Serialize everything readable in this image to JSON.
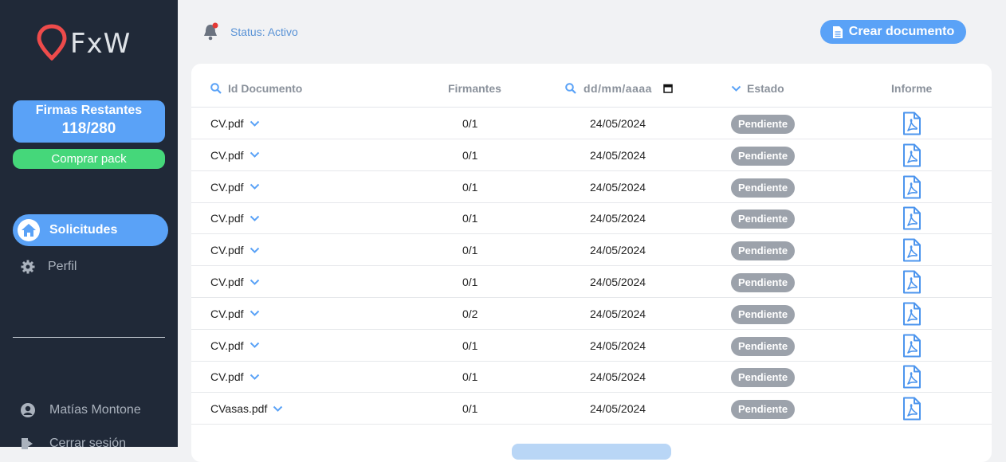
{
  "sidebar": {
    "logo_text": "FxW",
    "firmas_title": "Firmas Restantes",
    "firmas_value": "118/280",
    "comprar_label": "Comprar pack",
    "nav_solicitudes": "Solicitudes",
    "nav_perfil": "Perfil",
    "user_name": "Matías Montone",
    "logout_label": "Cerrar sesión"
  },
  "header": {
    "status": "Status: Activo",
    "crear_label": "Crear documento"
  },
  "table": {
    "headers": {
      "id": "Id Documento",
      "firmantes": "Firmantes",
      "fecha_placeholder": "dd/mm/aaaa",
      "estado": "Estado",
      "informe": "Informe"
    },
    "rows": [
      {
        "doc": "CV.pdf",
        "firmantes": "0/1",
        "fecha": "24/05/2024",
        "estado": "Pendiente"
      },
      {
        "doc": "CV.pdf",
        "firmantes": "0/1",
        "fecha": "24/05/2024",
        "estado": "Pendiente"
      },
      {
        "doc": "CV.pdf",
        "firmantes": "0/1",
        "fecha": "24/05/2024",
        "estado": "Pendiente"
      },
      {
        "doc": "CV.pdf",
        "firmantes": "0/1",
        "fecha": "24/05/2024",
        "estado": "Pendiente"
      },
      {
        "doc": "CV.pdf",
        "firmantes": "0/1",
        "fecha": "24/05/2024",
        "estado": "Pendiente"
      },
      {
        "doc": "CV.pdf",
        "firmantes": "0/1",
        "fecha": "24/05/2024",
        "estado": "Pendiente"
      },
      {
        "doc": "CV.pdf",
        "firmantes": "0/2",
        "fecha": "24/05/2024",
        "estado": "Pendiente"
      },
      {
        "doc": "CV.pdf",
        "firmantes": "0/1",
        "fecha": "24/05/2024",
        "estado": "Pendiente"
      },
      {
        "doc": "CV.pdf",
        "firmantes": "0/1",
        "fecha": "24/05/2024",
        "estado": "Pendiente"
      },
      {
        "doc": "CVasas.pdf",
        "firmantes": "0/1",
        "fecha": "24/05/2024",
        "estado": "Pendiente"
      }
    ]
  },
  "colors": {
    "accent": "#5aa2f7",
    "sidebar_bg": "#202938",
    "success": "#45d77a",
    "logo_red": "#ee4b4b",
    "badge_gray": "#9ca2ab"
  },
  "icons": [
    "pin-logo-icon",
    "home-icon",
    "gear-icon",
    "user-icon",
    "logout-icon",
    "bell-icon",
    "document-icon",
    "search-icon",
    "calendar-icon",
    "chevron-down-icon",
    "pdf-icon"
  ]
}
